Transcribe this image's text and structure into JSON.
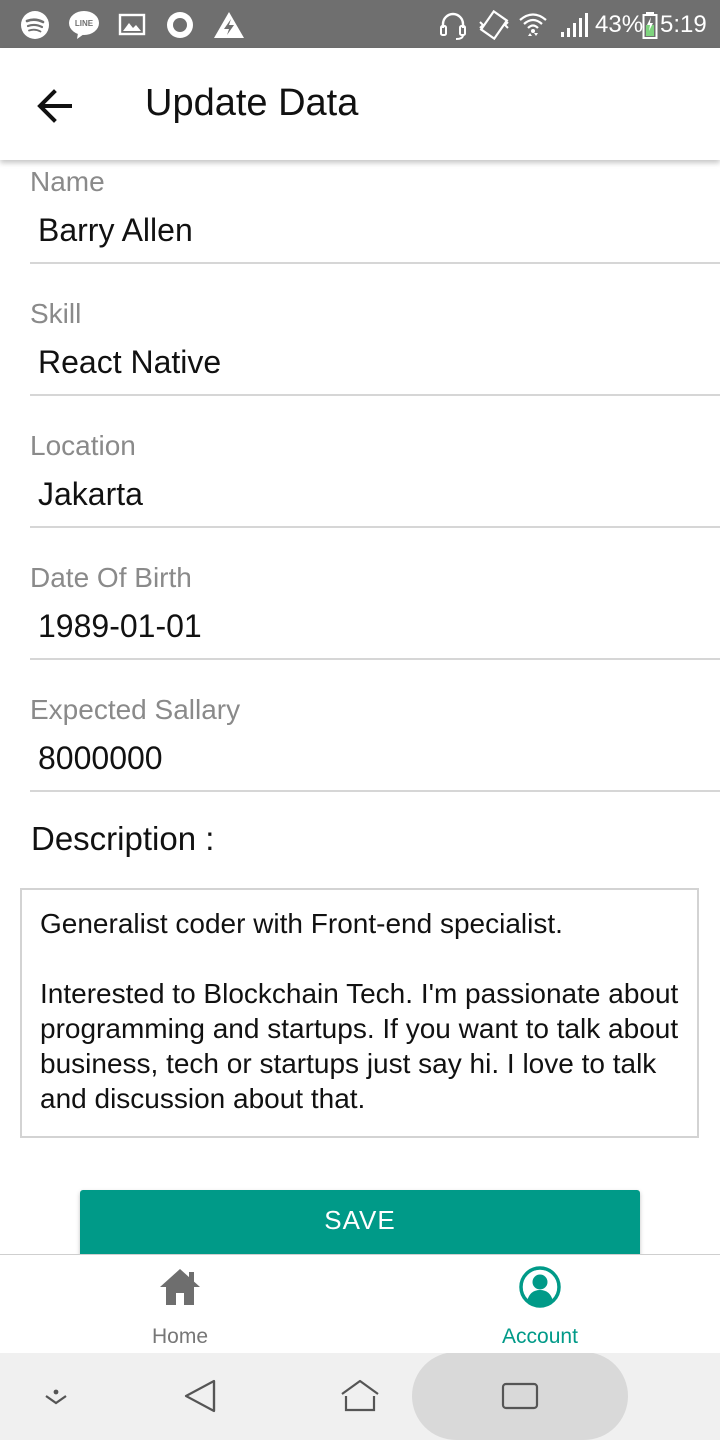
{
  "status_bar": {
    "battery": "43%",
    "time": "5:19",
    "icons": [
      "spotify-icon",
      "line-icon",
      "image-icon",
      "record-icon",
      "warning-icon",
      "headset-icon",
      "vibrate-icon",
      "wifi-icon",
      "signal-icon",
      "battery-icon"
    ]
  },
  "app_bar": {
    "title": "Update Data",
    "back_icon": "arrow-back-icon"
  },
  "form": {
    "name": {
      "label": "Name",
      "value": "Barry Allen"
    },
    "skill": {
      "label": "Skill",
      "value": "React Native"
    },
    "location": {
      "label": "Location",
      "value": "Jakarta"
    },
    "dob": {
      "label": "Date Of Birth",
      "value": "1989-01-01"
    },
    "salary": {
      "label": "Expected Sallary",
      "value": "8000000"
    },
    "description_title": "Description :",
    "description": "Generalist coder with Front-end specialist.\n\nInterested to Blockchain Tech. I'm passionate about programming and startups. If you want to talk about business, tech or startups just say hi. I love to talk and discussion about that.",
    "save_label": "SAVE"
  },
  "colors": {
    "accent": "#009a88",
    "status_bar": "#6f6f6f",
    "label_gray": "#8a8a8a",
    "divider": "#d6d6d6"
  },
  "bottom_nav": {
    "items": [
      {
        "label": "Home",
        "icon": "home-icon",
        "active": false
      },
      {
        "label": "Account",
        "icon": "account-icon",
        "active": true
      }
    ]
  },
  "system_nav": {
    "buttons": [
      "collapse-icon",
      "back-triangle-icon",
      "home-outline-icon",
      "recents-icon"
    ]
  }
}
